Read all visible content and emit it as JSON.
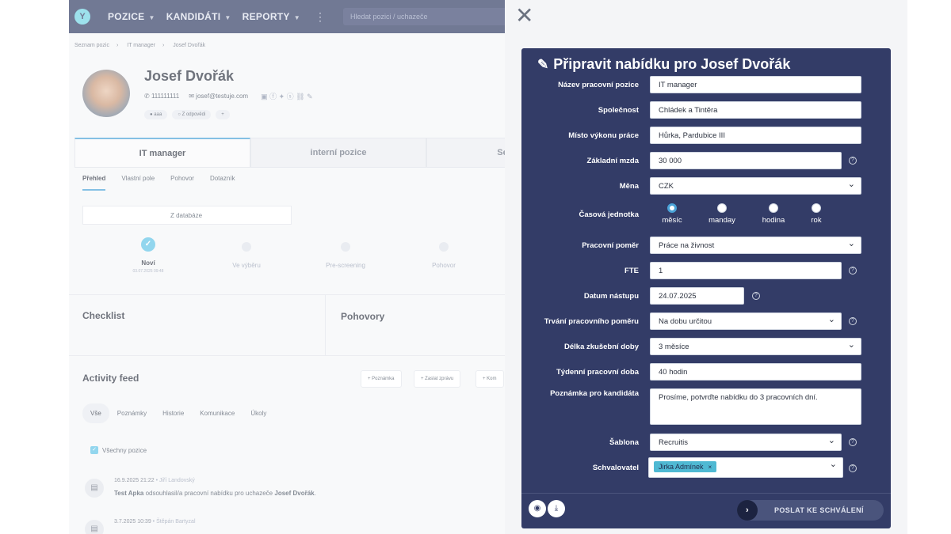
{
  "topbar": {
    "nav": [
      "POZICE",
      "KANDIDÁTI",
      "REPORTY"
    ],
    "search_placeholder": "Hledat pozici / uchazeče"
  },
  "breadcrumb": [
    "Seznam pozic",
    "IT manager",
    "Josef Dvořák"
  ],
  "candidate": {
    "name": "Josef Dvořák",
    "phone": "111111111",
    "email": "josef@testuje.com",
    "tags": [
      "aaa",
      "Z odpovědi"
    ]
  },
  "position_tabs": [
    "IT manager",
    "interní pozice",
    "Senior J"
  ],
  "sub_tabs": [
    "Přehled",
    "Vlastní pole",
    "Pohovor",
    "Dotazník"
  ],
  "source": "Z databáze",
  "pipeline": {
    "steps": [
      "Noví",
      "Ve výběru",
      "Pre-screening",
      "Pohovor"
    ],
    "first_date": "03.07.2025 09:48"
  },
  "sections": {
    "checklist": "Checklist",
    "pohovory": "Pohovory"
  },
  "activity": {
    "title": "Activity feed",
    "buttons": [
      "Poznámka",
      "Zaslat zprávu",
      "Kom"
    ],
    "tabs": [
      "Vše",
      "Poznámky",
      "Historie",
      "Komunikace",
      "Úkoly"
    ],
    "filter": "Všechny pozice",
    "items": [
      {
        "time": "16.9.2025 21:22",
        "user": "Jiří Landovský",
        "actor": "Test Apka",
        "text": "odsouhlasil/a pracovní nabídku pro uchazeče",
        "target": "Josef Dvořák",
        "end": "."
      },
      {
        "time": "3.7.2025 10:39",
        "user": "Štěpán Bartyzal"
      }
    ]
  },
  "modal": {
    "title": "Připravit nabídku pro Josef Dvořák",
    "fields": {
      "position_label": "Název pracovní pozice",
      "position": "IT manager",
      "company_label": "Společnost",
      "company": "Chládek a Tintěra",
      "place_label": "Místo výkonu práce",
      "place": "Hůrka,  Pardubice III",
      "salary_label": "Základní mzda",
      "salary": "30 000",
      "currency_label": "Měna",
      "currency": "CZK",
      "unit_label": "Časová jednotka",
      "unit_options": [
        "měsíc",
        "manday",
        "hodina",
        "rok"
      ],
      "unit_selected": "měsíc",
      "relation_label": "Pracovní poměr",
      "relation": "Práce na živnost",
      "fte_label": "FTE",
      "fte": "1",
      "start_label": "Datum nástupu",
      "start": "24.07.2025",
      "duration_label": "Trvání pracovního poměru",
      "duration": "Na dobu určitou",
      "probation_label": "Délka zkušební doby",
      "probation": "3 měsíce",
      "hours_label": "Týdenní pracovní doba",
      "hours": "40 hodin",
      "note_label": "Poznámka pro kandidáta",
      "note": "Prosíme, potvrďte nabídku do 3 pracovních dní.",
      "template_label": "Šablona",
      "template": "Recruitis",
      "approver_label": "Schvalovatel",
      "approver": "Jirka Admínek"
    },
    "send_button": "POSLAT KE SCHVÁLENÍ"
  },
  "colors": {
    "modal_bg": "#333c67",
    "topbar_bg": "#2f3a62",
    "accent": "#4aa3d8"
  }
}
